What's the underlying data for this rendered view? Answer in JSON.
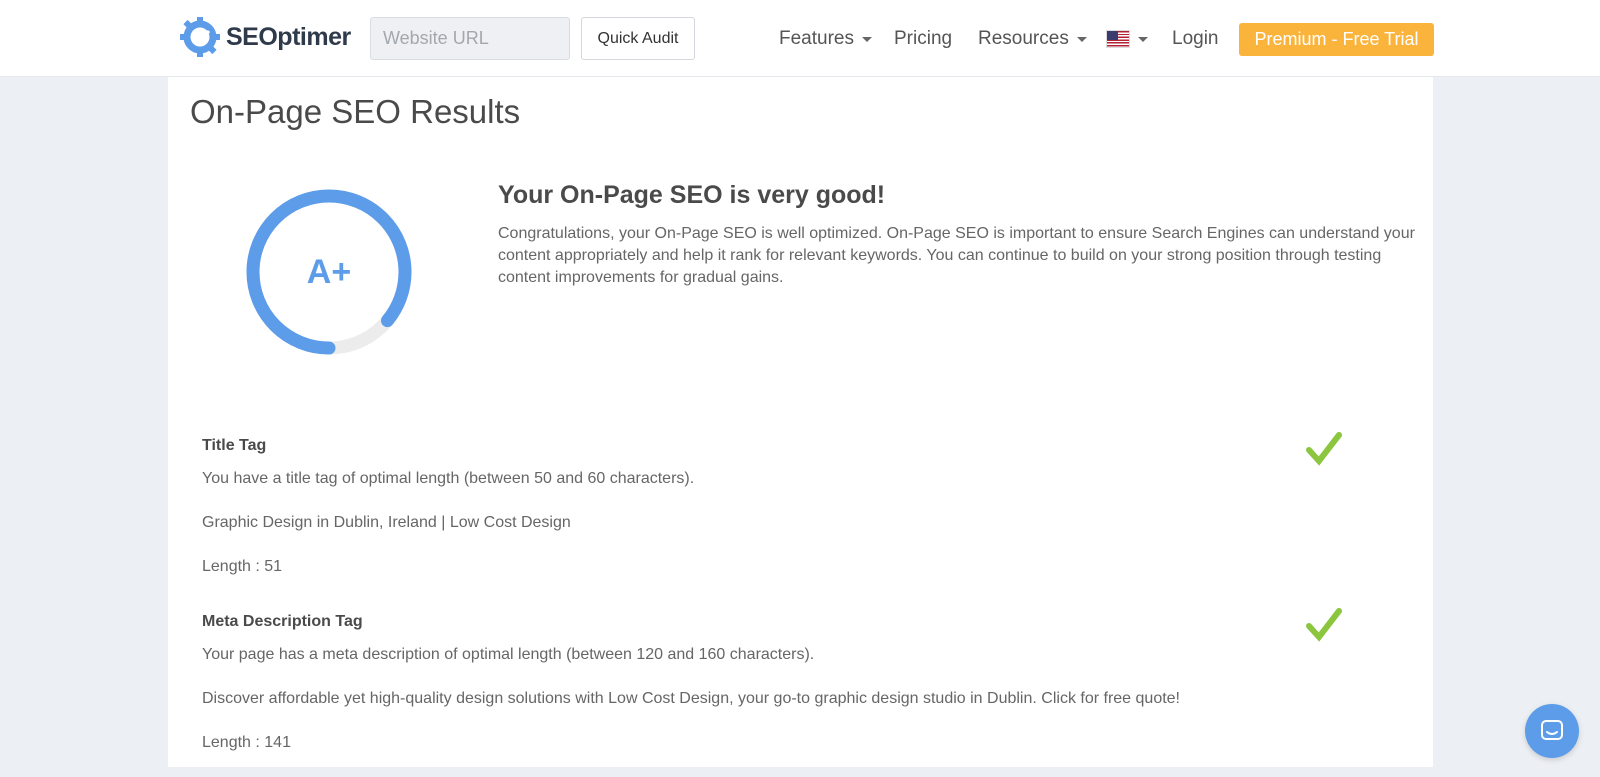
{
  "header": {
    "logo_text": "SEOptimer",
    "url_placeholder": "Website URL",
    "quick_audit_label": "Quick Audit",
    "nav": {
      "features": "Features",
      "pricing": "Pricing",
      "resources": "Resources",
      "login": "Login"
    },
    "trial_label": "Premium - Free Trial"
  },
  "main": {
    "page_title": "On-Page SEO Results",
    "score": {
      "grade": "A+",
      "progress": 0.86,
      "color": "#5d9ce8",
      "track_color": "#ececec"
    },
    "summary_heading": "Your On-Page SEO is very good!",
    "summary_text": "Congratulations, your On-Page SEO is well optimized. On-Page SEO is important to ensure Search Engines can understand your content appropriately and help it rank for relevant keywords. You can continue to build on your strong position through testing content improvements for gradual gains.",
    "checks": [
      {
        "title": "Title Tag",
        "message": "You have a title tag of optimal length (between 50 and 60 characters).",
        "value": "Graphic Design in Dublin, Ireland | Low Cost Design",
        "length": "Length : 51",
        "status": "pass"
      },
      {
        "title": "Meta Description Tag",
        "message": "Your page has a meta description of optimal length (between 120 and 160 characters).",
        "value": "Discover affordable yet high-quality design solutions with Low Cost Design, your go-to graphic design studio in Dublin. Click for free quote!",
        "length": "Length : 141",
        "status": "pass"
      }
    ]
  },
  "colors": {
    "accent": "#5d9ce8",
    "trial": "#fbb43b",
    "pass": "#8cc63f"
  },
  "icons": {
    "pass": "checkmark-icon",
    "chat": "chat-icon"
  }
}
